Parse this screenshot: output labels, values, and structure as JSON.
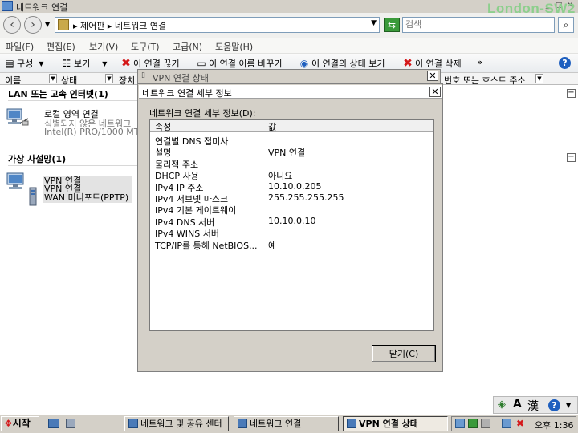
{
  "window": {
    "title": "네트워크 연결"
  },
  "watermark": "London-SW2",
  "address": {
    "breadcrumb": "▸ 제어판 ▸ 네트워크 연결",
    "search_placeholder": "검색"
  },
  "menu": [
    "파일(F)",
    "편집(E)",
    "보기(V)",
    "도구(T)",
    "고급(N)",
    "도움말(H)"
  ],
  "toolbar": {
    "organize": "구성",
    "view": "보기",
    "disable": "이 연결 끊기",
    "rename": "이 연결 이름 바꾸기",
    "status": "이 연결의 상태 보기",
    "delete": "이 연결 삭제",
    "more": "»"
  },
  "columns": {
    "name": "이름",
    "status": "상태",
    "device": "장치",
    "phone": "번호 또는 호스트 주소"
  },
  "groups": {
    "lan": {
      "title": "LAN 또는 고속 인터넷(1)",
      "item": {
        "line1": "로컬 영역 연결",
        "line2": "식별되지 않은 네트워크",
        "line3": "Intel(R) PRO/1000 MT"
      }
    },
    "vpn": {
      "title": "가상 사설망(1)",
      "item": {
        "line1": "VPN 연결",
        "line2": "VPN 연결",
        "line3": "WAN 미니포트(PPTP)"
      }
    }
  },
  "status_dialog": {
    "title": "VPN 연결 상태"
  },
  "details_dialog": {
    "title": "네트워크 연결 세부 정보",
    "label": "네트워크 연결 세부 정보(D):",
    "col_property": "속성",
    "col_value": "값",
    "rows": [
      {
        "property": "연결별 DNS 접미사",
        "value": ""
      },
      {
        "property": "설명",
        "value": "VPN 연결"
      },
      {
        "property": "물리적 주소",
        "value": ""
      },
      {
        "property": "DHCP 사용",
        "value": "아니요"
      },
      {
        "property": "IPv4 IP 주소",
        "value": "10.10.0.205"
      },
      {
        "property": "IPv4 서브넷 마스크",
        "value": "255.255.255.255"
      },
      {
        "property": "IPv4 기본 게이트웨이",
        "value": ""
      },
      {
        "property": "IPv4 DNS 서버",
        "value": "10.10.0.10"
      },
      {
        "property": "IPv4 WINS 서버",
        "value": ""
      },
      {
        "property": "TCP/IP를 통해 NetBIOS...",
        "value": "예"
      }
    ],
    "close_label": "닫기(C)"
  },
  "langbar": {
    "mode": "A",
    "hanja": "漢"
  },
  "taskbar": {
    "start": "시작",
    "tasks": [
      "네트워크 및 공유 센터",
      "네트워크 연결",
      "VPN 연결 상태"
    ],
    "clock": "오후 1:36"
  }
}
